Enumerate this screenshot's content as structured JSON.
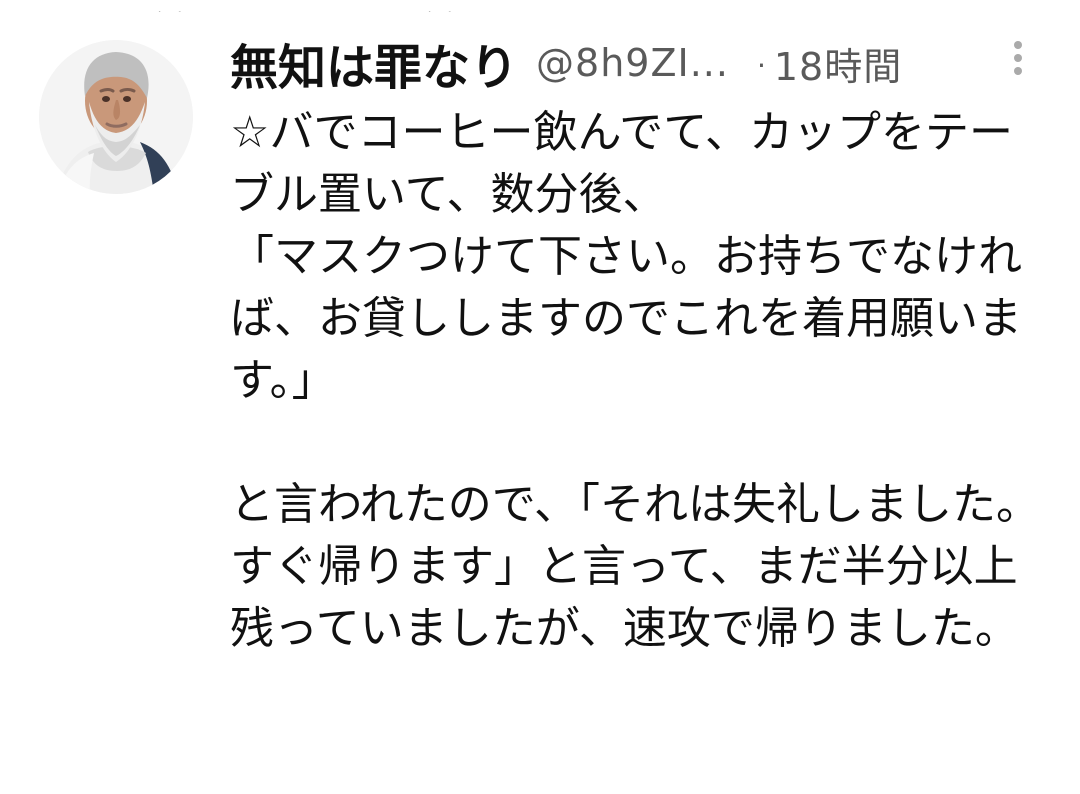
{
  "tweet": {
    "display_name": "無知は罪なり",
    "handle": "@8h9ZI...",
    "separator": "·",
    "timestamp": "18時間",
    "body": "☆バでコーヒー飲んでて、カップをテーブル置いて、数分後、\n「マスクつけて下さい。お持ちでなければ、お貸ししますのでこれを着用願います。」\n\nと言われたので、「それは失礼しました。すぐ帰ります」と言って、まだ半分以上残っていましたが、速攻で帰りました。"
  },
  "icons": {
    "menu": "more-vertical-icon"
  }
}
